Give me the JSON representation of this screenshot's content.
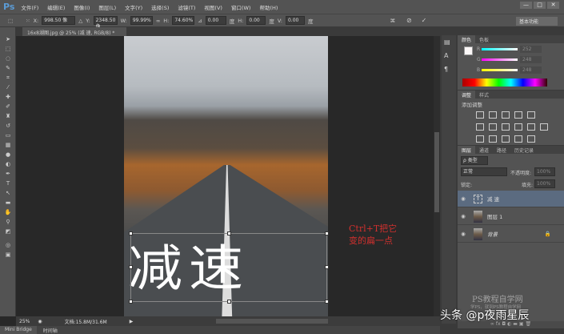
{
  "app": {
    "logo": "Ps"
  },
  "menu": [
    "文件(F)",
    "编辑(E)",
    "图像(I)",
    "图层(L)",
    "文字(Y)",
    "选择(S)",
    "滤镜(T)",
    "视图(V)",
    "窗口(W)",
    "帮助(H)"
  ],
  "window_buttons": [
    "—",
    "□",
    "✕"
  ],
  "options": {
    "x_label": "X:",
    "x": "998.50 像",
    "y_label": "Y:",
    "y": "2348.50 像",
    "w_label": "W:",
    "w": "99.99%",
    "h_label": "H:",
    "h": "74.60%",
    "angle": "0.00",
    "angle_unit": "度",
    "hskew_label": "H:",
    "hskew": "0.00",
    "hskew_unit": "度",
    "vskew_label": "V:",
    "vskew": "0.00",
    "vskew_unit": "度",
    "workspace": "基本功能"
  },
  "document": {
    "tab": "16x8湖图.jpg @ 25% (减 速, RGB/8) *",
    "text_layer": "减速"
  },
  "annotation": {
    "line1": "Ctrl+T把它",
    "line2": "变的扁一点"
  },
  "status": {
    "zoom": "25%",
    "doc": "文档:15.8M/31.6M"
  },
  "bottom_tabs": [
    "Mini Bridge",
    "时间轴"
  ],
  "color_panel": {
    "tabs": [
      "颜色",
      "色板"
    ],
    "r_label": "R",
    "r": "252",
    "g_label": "G",
    "g": "248",
    "b_label": "B",
    "b": "248"
  },
  "adjust_panel": {
    "tabs": [
      "调整",
      "样式"
    ],
    "title": "添加调整"
  },
  "layers_panel": {
    "tabs": [
      "图层",
      "通道",
      "路径",
      "历史记录"
    ],
    "filter": "ρ 类型",
    "blend": "正常",
    "opacity_label": "不透明度:",
    "opacity": "100%",
    "lock_label": "锁定:",
    "fill_label": "填充:",
    "fill": "100%",
    "layers": [
      {
        "name": "减 速",
        "type": "text"
      },
      {
        "name": "图层 1",
        "type": "image"
      },
      {
        "name": "背景",
        "type": "image",
        "locked": true
      }
    ]
  },
  "watermark": {
    "title": "PS教程自学网",
    "sub": "学PS，就到PS教程自学网",
    "credit": "头条 @p夜雨星辰"
  }
}
